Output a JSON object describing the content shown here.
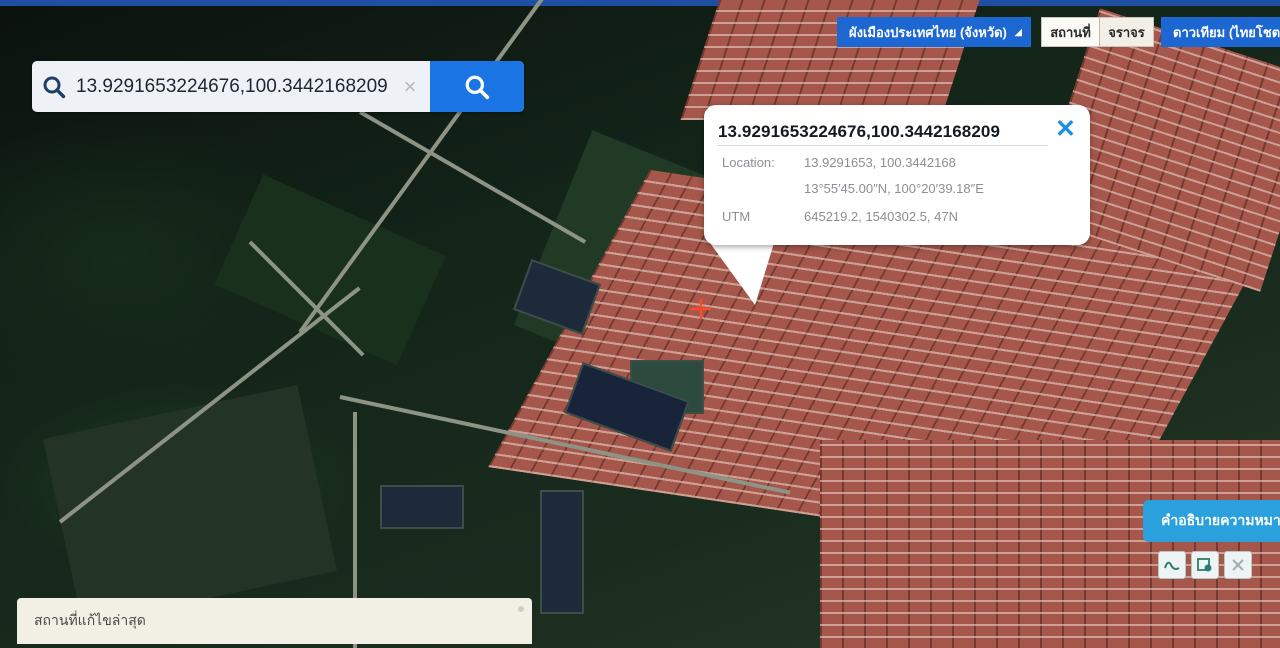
{
  "search": {
    "value": "13.9291653224676,100.3442168209",
    "clear_label": "×"
  },
  "layers": {
    "main_label": "ผังเมืองประเทศไทย (จังหวัด)",
    "main_caret": "◢",
    "seg_places": "สถานที่",
    "seg_traffic": "จราจร",
    "satellite_label": "ดาวเทียม (ไทยโชต"
  },
  "popup": {
    "title": "13.9291653224676,100.3442168209",
    "close_label": "✕",
    "location_label": "Location:",
    "location_value": "13.9291653, 100.3442168",
    "dms_value": "13°55′45.00″N, 100°20′39.18″E",
    "utm_label": "UTM",
    "utm_value": "645219.2, 1540302.5, 47N"
  },
  "recent": {
    "label": "สถานที่แก้ไขล่าสุด"
  },
  "legend": {
    "label": "คำอธิบายความหมาย"
  },
  "icons": {
    "search": "search-icon",
    "clear": "close-icon",
    "marker": "crosshair-marker-icon",
    "tool1": "line-tool-icon",
    "tool2": "area-tool-icon",
    "tool3": "clear-tool-icon"
  },
  "colors": {
    "primary_blue": "#1c67d2",
    "search_button": "#1b74e4",
    "legend_button": "#2aa0dc",
    "marker": "#ff4b2b"
  }
}
